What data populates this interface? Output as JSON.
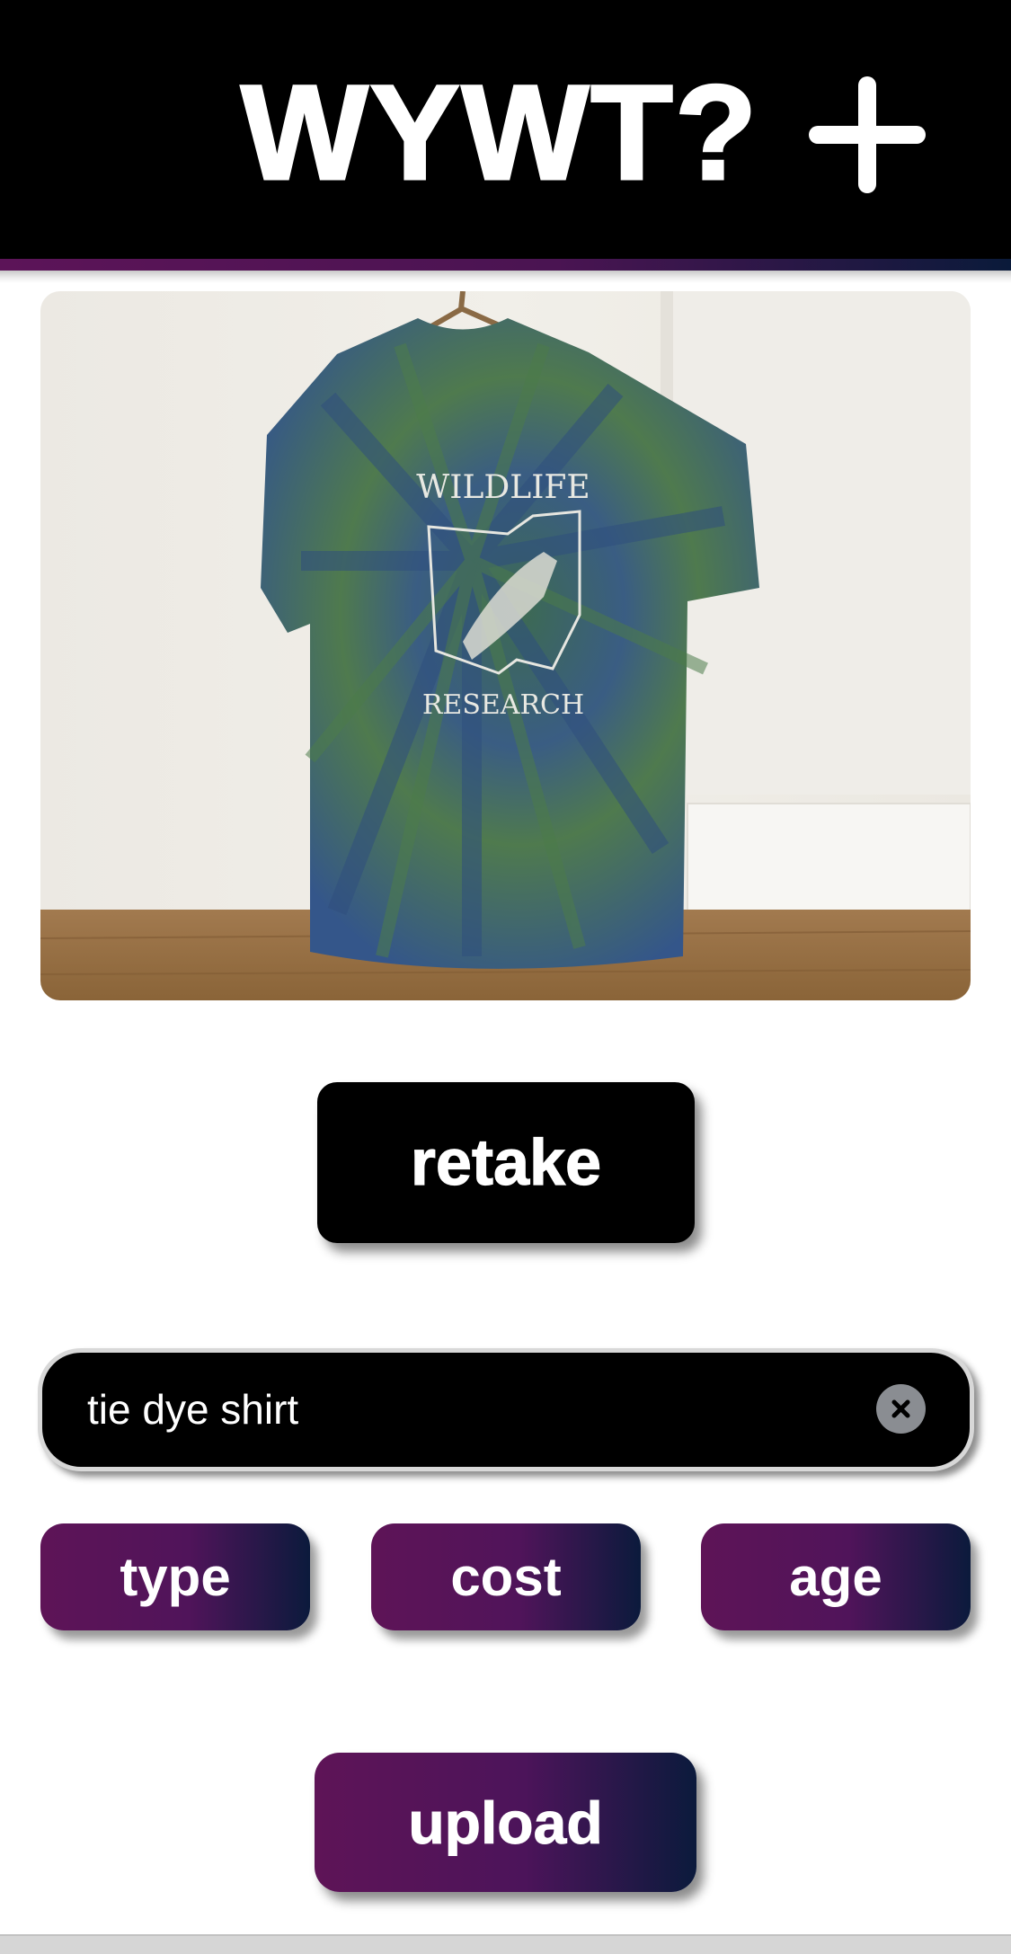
{
  "header": {
    "title": "WYWT?",
    "add_icon": "plus-icon"
  },
  "photo": {
    "print_line1": "WILDLIFE",
    "print_line2": "RESEARCH"
  },
  "actions": {
    "retake_label": "retake",
    "upload_label": "upload"
  },
  "search": {
    "value": "tie dye shirt",
    "clear_icon": "close-icon"
  },
  "tags": {
    "items": [
      {
        "label": "type"
      },
      {
        "label": "cost"
      },
      {
        "label": "age"
      }
    ]
  },
  "colors": {
    "header_bg": "#000000",
    "accent_start": "#5e1457",
    "accent_end": "#0b1a3c"
  }
}
